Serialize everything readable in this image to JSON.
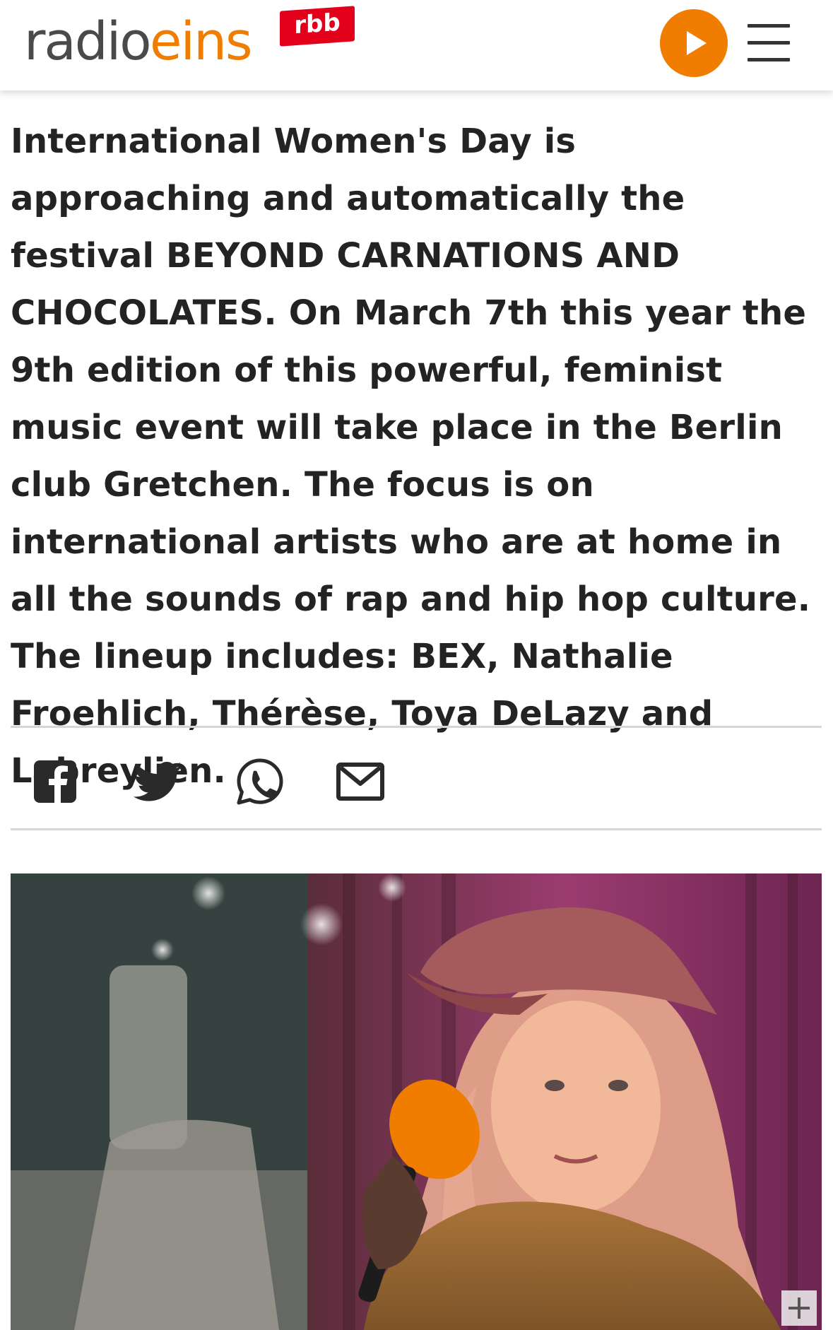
{
  "header": {
    "logo": {
      "part1": "radio",
      "part2": "eins",
      "badge": "rbb"
    },
    "play_icon": "play-icon",
    "menu_icon": "hamburger-menu-icon"
  },
  "article": {
    "body": "International Women's Day is approaching and automatically the festival BEYOND CARNATIONS AND CHOCOLATES. On March 7th this year the 9th edition of this powerful, feminist music event will take place in the Berlin club Gretchen. The focus is on international artists who are at home in all the sounds of rap and hip hop culture. The lineup includes: BEX, Nathalie Froehlich, Thérèse, Toya DeLazy and Labreylien."
  },
  "share": {
    "icons": [
      "facebook-icon",
      "twitter-icon",
      "whatsapp-icon",
      "email-icon"
    ]
  },
  "photo": {
    "expand_icon": "plus-icon"
  },
  "colors": {
    "brand_orange": "#f07d00",
    "rbb_red": "#e3001b",
    "text": "#232323",
    "divider": "#d6d6d6"
  }
}
